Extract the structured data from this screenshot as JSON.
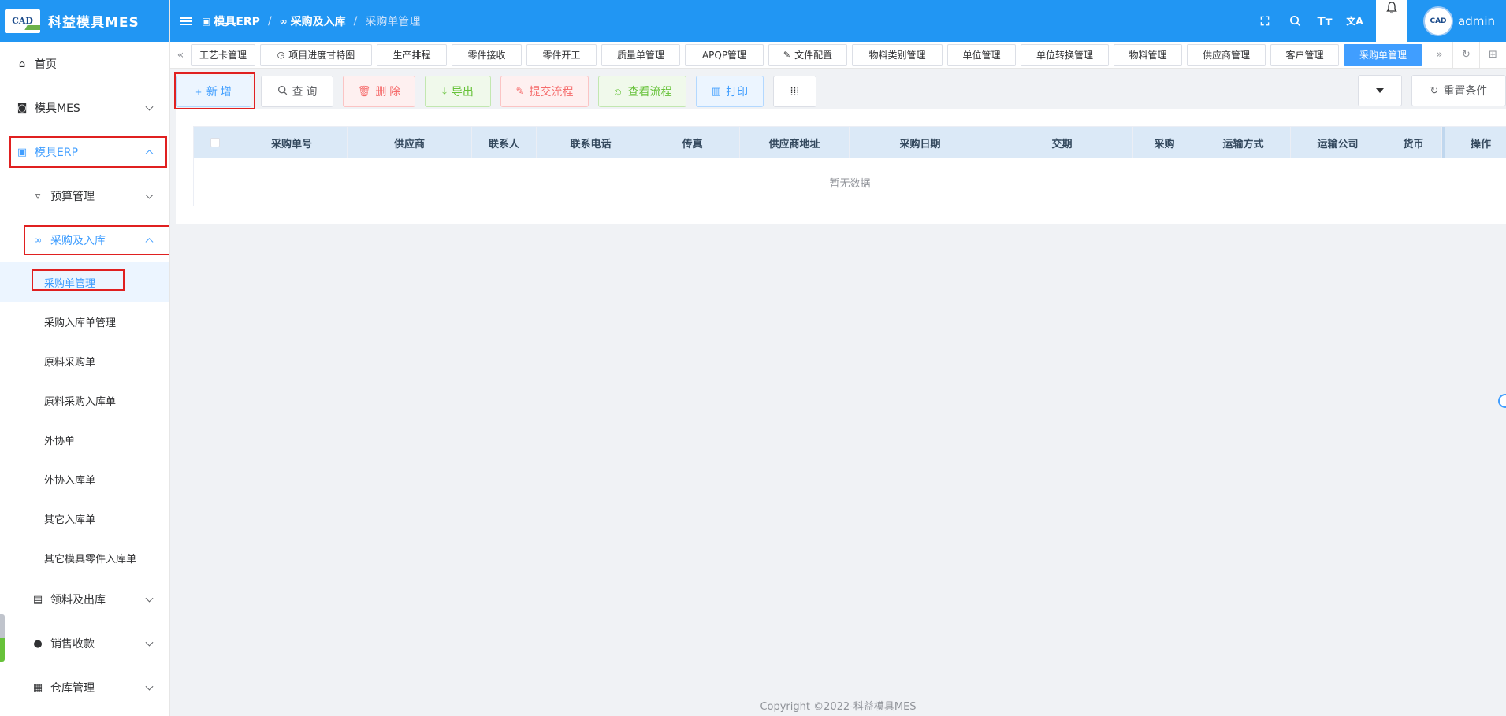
{
  "app": {
    "logo_text": "CAD",
    "title": "科益模具MES"
  },
  "sidebar": {
    "items": [
      {
        "label": "首页",
        "icon": "home-icon"
      },
      {
        "label": "模具MES",
        "icon": "camera-icon"
      },
      {
        "label": "模具ERP",
        "icon": "box-icon"
      },
      {
        "label": "预算管理",
        "icon": "filter-icon"
      },
      {
        "label": "采购及入库",
        "icon": "bicycle-icon"
      },
      {
        "label": "采购单管理"
      },
      {
        "label": "采购入库单管理"
      },
      {
        "label": "原料采购单"
      },
      {
        "label": "原料采购入库单"
      },
      {
        "label": "外协单"
      },
      {
        "label": "外协入库单"
      },
      {
        "label": "其它入库单"
      },
      {
        "label": "其它模具零件入库单"
      },
      {
        "label": "领料及出库",
        "icon": "building-icon"
      },
      {
        "label": "销售收款",
        "icon": "user-icon"
      },
      {
        "label": "仓库管理",
        "icon": "calendar-icon"
      }
    ]
  },
  "header": {
    "breadcrumb": [
      "模具ERP",
      "采购及入库",
      "采购单管理"
    ],
    "username": "admin",
    "font_icon_text": "Tт",
    "translate_icon_text": "文A",
    "avatar_text": "CAD"
  },
  "tabs": [
    {
      "label": "工艺卡管理"
    },
    {
      "label": "项目进度甘特图"
    },
    {
      "label": "生产排程"
    },
    {
      "label": "零件接收"
    },
    {
      "label": "零件开工"
    },
    {
      "label": "质量单管理"
    },
    {
      "label": "APQP管理"
    },
    {
      "label": "文件配置"
    },
    {
      "label": "物料类别管理"
    },
    {
      "label": "单位管理"
    },
    {
      "label": "单位转换管理"
    },
    {
      "label": "物料管理"
    },
    {
      "label": "供应商管理"
    },
    {
      "label": "客户管理"
    },
    {
      "label": "采购单管理"
    }
  ],
  "toolbar": {
    "add": "新 增",
    "query": "查 询",
    "delete": "删 除",
    "export": "导出",
    "submit_flow": "提交流程",
    "view_flow": "查看流程",
    "print": "打印",
    "reset": "重置条件"
  },
  "table": {
    "columns": [
      "采购单号",
      "供应商",
      "联系人",
      "联系电话",
      "传真",
      "供应商地址",
      "采购日期",
      "交期",
      "采购",
      "运输方式",
      "运输公司",
      "货币",
      "操作"
    ],
    "empty_text": "暂无数据"
  },
  "footer": {
    "copyright": "Copyright ©2022-科益模具MES"
  },
  "colors": {
    "primary": "#2196f3",
    "accent": "#409eff",
    "highlight_border": "#e02020"
  }
}
